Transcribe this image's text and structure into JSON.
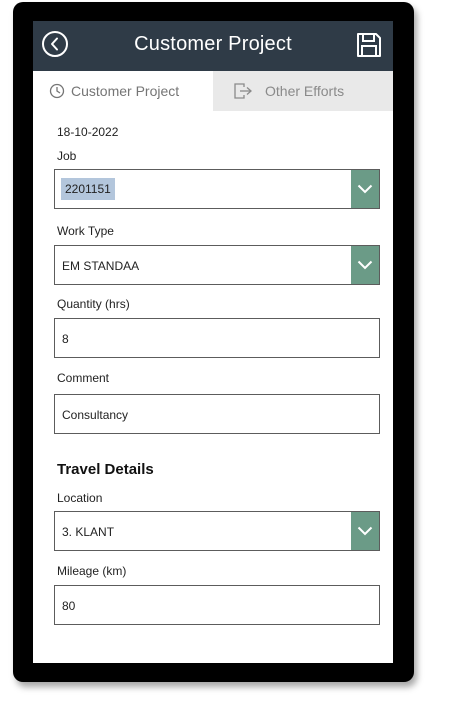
{
  "header": {
    "title": "Customer Project"
  },
  "tabs": [
    {
      "label": "Customer Project"
    },
    {
      "label": "Other Efforts"
    }
  ],
  "form": {
    "date": "18-10-2022",
    "job": {
      "label": "Job",
      "value": "2201151"
    },
    "work_type": {
      "label": "Work Type",
      "value": "EM STANDAA"
    },
    "quantity": {
      "label": "Quantity (hrs)",
      "value": "8"
    },
    "comment": {
      "label": "Comment",
      "value": "Consultancy"
    }
  },
  "travel": {
    "title": "Travel Details",
    "location": {
      "label": "Location",
      "value": "3. KLANT"
    },
    "mileage": {
      "label": "Mileage (km)",
      "value": "80"
    }
  },
  "colors": {
    "header_bg": "#2f3b47",
    "dropdown_button": "#6b9b87",
    "inactive_tab": "#e9e9e9",
    "selection": "#b3c6dc"
  }
}
